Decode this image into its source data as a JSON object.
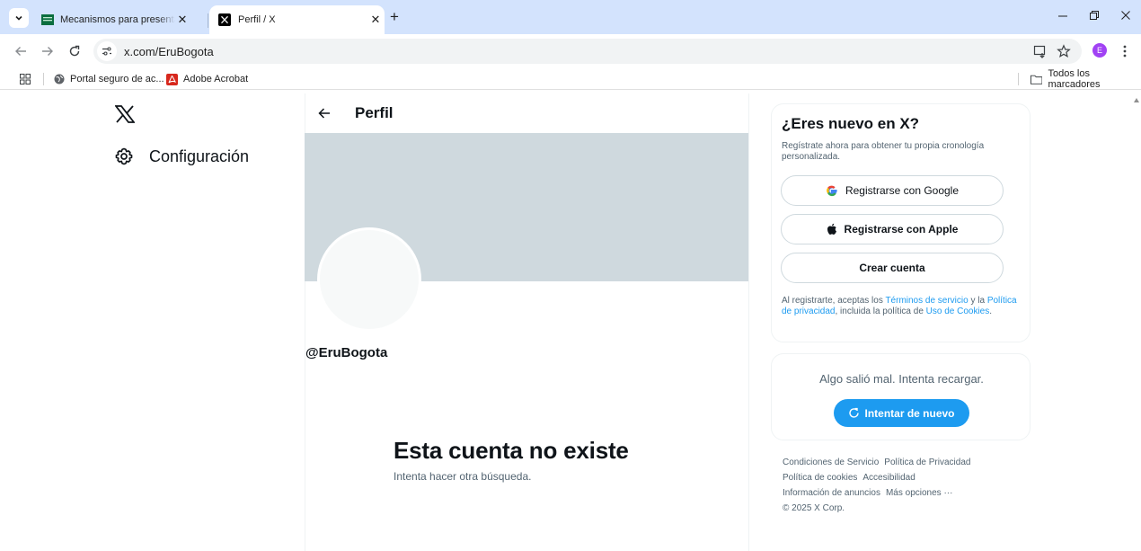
{
  "browser": {
    "tabs": [
      {
        "title": "Mecanismos para presentar Pet",
        "active": false
      },
      {
        "title": "Perfil / X",
        "active": true
      }
    ],
    "tab_close": "✕",
    "new_tab": "+",
    "address": "x.com/EruBogota",
    "profile_initial": "E",
    "bookmarks": [
      {
        "label": "Portal seguro de ac..."
      },
      {
        "label": "Adobe Acrobat"
      }
    ],
    "all_bookmarks": "Todos los marcadores"
  },
  "sidebar": {
    "settings_label": "Configuración"
  },
  "profile": {
    "header_title": "Perfil",
    "handle": "@EruBogota",
    "not_found_title": "Esta cuenta no existe",
    "not_found_sub": "Intenta hacer otra búsqueda."
  },
  "signup": {
    "title": "¿Eres nuevo en X?",
    "description": "Regístrate ahora para obtener tu propia cronología personalizada.",
    "google_label": "Registrarse con Google",
    "apple_label": "Registrarse con Apple",
    "create_label": "Crear cuenta",
    "legal": {
      "p1": "Al registrarte, aceptas los ",
      "terms": "Términos de servicio",
      "p2": " y la ",
      "privacy": "Política de privacidad",
      "p3": ", incluida la política de ",
      "cookies": "Uso de Cookies",
      "p4": "."
    }
  },
  "error": {
    "message": "Algo salió mal. Intenta recargar.",
    "retry_label": "Intentar de nuevo"
  },
  "footer": {
    "links": [
      "Condiciones de Servicio",
      "Política de Privacidad",
      "Política de cookies",
      "Accesibilidad",
      "Información de anuncios",
      "Más opciones ···"
    ],
    "copyright": "© 2025 X Corp."
  },
  "colors": {
    "accent": "#1d9bf0",
    "tabbar": "#d3e3fd",
    "banner": "#cfd9de"
  }
}
